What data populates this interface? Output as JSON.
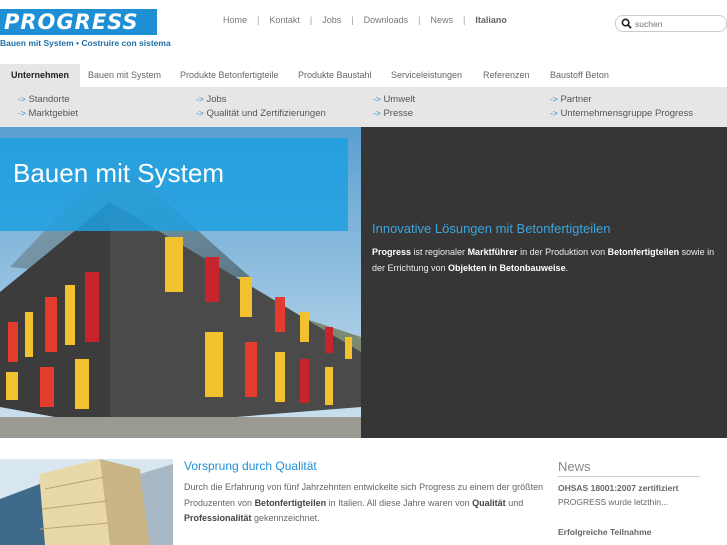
{
  "brand": {
    "logo_text": "PROGRESS",
    "tagline": "Bauen mit System • Costruire con sistema",
    "accent_color": "#1e8fd5"
  },
  "topnav": {
    "items": [
      "Home",
      "Kontakt",
      "Jobs",
      "Downloads",
      "News"
    ],
    "language": "Italiano"
  },
  "search": {
    "placeholder": "suchen",
    "icon": "search-icon"
  },
  "mainnav": {
    "tabs": [
      {
        "label": "Unternehmen",
        "active": true
      },
      {
        "label": "Bauen mit System",
        "active": false
      },
      {
        "label": "Produkte Betonfertigteile",
        "active": false
      },
      {
        "label": "Produkte Baustahl",
        "active": false
      },
      {
        "label": "Serviceleistungen",
        "active": false
      },
      {
        "label": "Referenzen",
        "active": false
      },
      {
        "label": "Baustoff Beton",
        "active": false
      }
    ]
  },
  "subnav": {
    "arrow": "->",
    "links": [
      "Standorte",
      "Jobs",
      "Umwelt",
      "Partner",
      "Marktgebiet",
      "Qualität und Zertifizierungen",
      "Presse",
      "Unternehmensgruppe Progress"
    ]
  },
  "hero": {
    "title": "Bauen mit System",
    "heading": "Innovative Lösungen mit Betonfertigteilen",
    "text": {
      "brand": "Progress",
      "p1": " ist regionaler ",
      "b1": "Marktführer",
      "p2": " in der Produktion von ",
      "b2": "Betonfertigteilen",
      "p3": " sowie in der Errichtung von ",
      "b3": "Objekten in Betonbauweise",
      "p4": "."
    }
  },
  "quality": {
    "heading": "Vorsprung durch Qualität",
    "text": {
      "p1": "Durch die Erfahrung von fünf Jahrzehnten entwickelte sich Progress zu einem der größten Produzenten von ",
      "b1": "Betonfertigteilen",
      "p2": " in Italien. All diese Jahre waren von ",
      "b2": "Qualität",
      "p3": " und ",
      "b3": "Professionalität",
      "p4": " gekennzeichnet."
    }
  },
  "news": {
    "heading": "News",
    "items": [
      {
        "title": "OHSAS 18001:2007 zertifiziert",
        "text": "PROGRESS wurde letzthin..."
      },
      {
        "title": "Erfolgreiche Teilnahme",
        "text": ""
      }
    ]
  }
}
